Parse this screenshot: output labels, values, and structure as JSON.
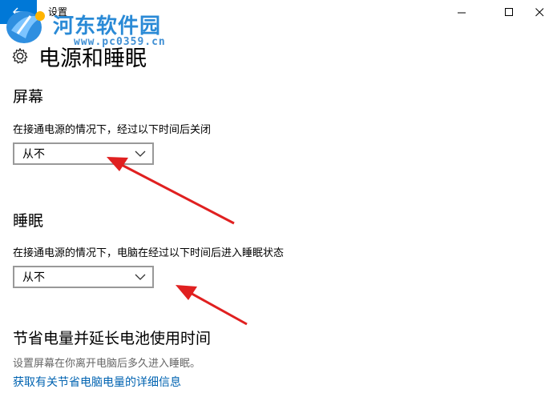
{
  "window": {
    "title": "设置",
    "back_icon": "back-arrow-icon",
    "controls": [
      "minimize-icon",
      "maximize-icon",
      "close-icon"
    ]
  },
  "watermark": {
    "name": "河东软件园",
    "url": "www.pc0359.cn"
  },
  "page": {
    "title": "电源和睡眠",
    "icon": "gear-icon"
  },
  "screen": {
    "heading": "屏幕",
    "description": "在接通电源的情况下，经过以下时间后关闭",
    "selected": "从不"
  },
  "sleep": {
    "heading": "睡眠",
    "description": "在接通电源的情况下，电脑在经过以下时间后进入睡眠状态",
    "selected": "从不"
  },
  "battery": {
    "heading": "节省电量并延长电池使用时间",
    "description": "设置屏幕在你离开电脑后多久进入睡眠。",
    "link": "获取有关节省电脑电量的详细信息"
  },
  "colors": {
    "accent": "#0078d7",
    "link": "#0063b1",
    "annotation_arrow": "#e02020"
  }
}
